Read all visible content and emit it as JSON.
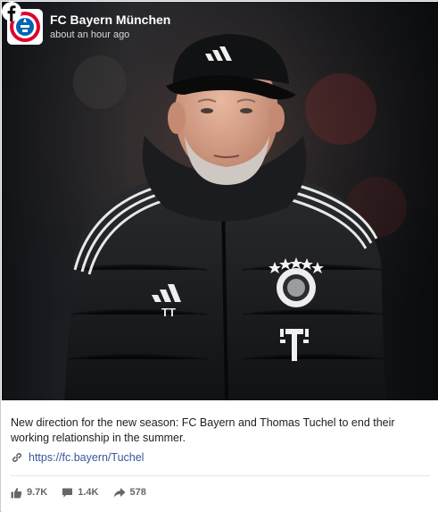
{
  "post": {
    "page_name": "FC Bayern München",
    "timestamp": "about an hour ago",
    "text": "New direction for the new season: FC Bayern and Thomas Tuchel to end their working relationship in the summer.",
    "link": "https://fc.bayern/Tuchel"
  },
  "image": {
    "cap_logo_text": "",
    "jacket_initials": "TT",
    "crest_text": "FC BAYERN MÜNCHEN",
    "sponsor_text": "T"
  },
  "stats": {
    "likes": "9.7K",
    "comments": "1.4K",
    "shares": "578"
  },
  "icons": {
    "verified": "verified-icon",
    "facebook": "facebook-icon",
    "link": "link-icon",
    "like": "like-icon",
    "comment": "comment-icon",
    "share": "share-icon"
  },
  "colors": {
    "facebook_blue": "#1877f2",
    "bayern_red": "#dc052d",
    "link_blue": "#385898",
    "meta_grey": "#65676b"
  }
}
